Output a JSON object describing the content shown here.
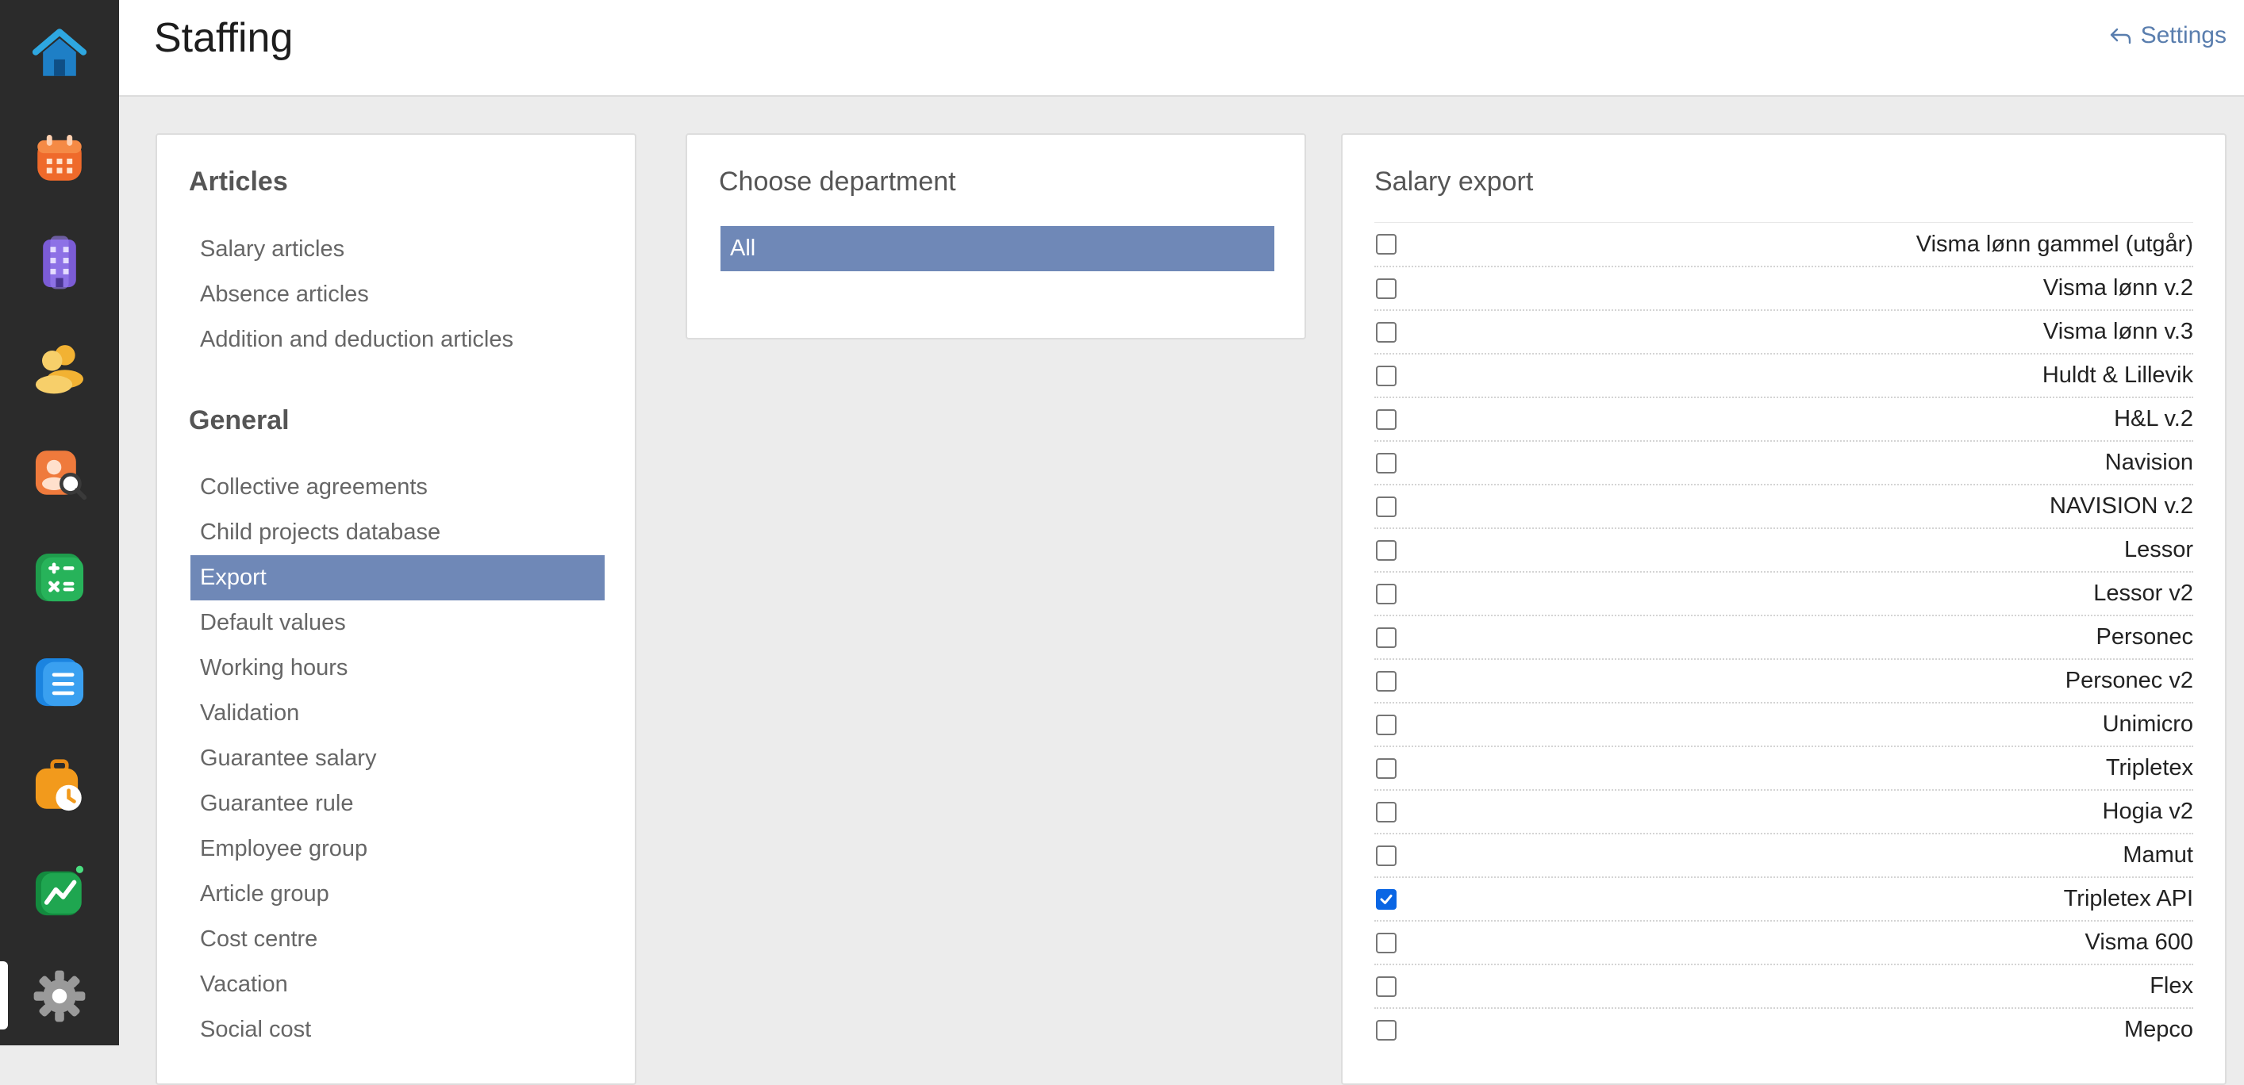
{
  "header": {
    "title": "Staffing",
    "settings_label": "Settings"
  },
  "rail": {
    "items": [
      "home-icon",
      "calendar-icon",
      "building-icon",
      "people-icon",
      "person-search-icon",
      "calculator-icon",
      "document-list-icon",
      "clock-briefcase-icon",
      "chart-icon",
      "gear-icon"
    ],
    "active": "gear-icon"
  },
  "articles": {
    "title": "Articles",
    "items": [
      "Salary articles",
      "Absence articles",
      "Addition and deduction articles"
    ]
  },
  "general": {
    "title": "General",
    "items": [
      "Collective agreements",
      "Child projects database",
      "Export",
      "Default values",
      "Working hours",
      "Validation",
      "Guarantee salary",
      "Guarantee rule",
      "Employee group",
      "Article group",
      "Cost centre",
      "Vacation",
      "Social cost"
    ],
    "active": "Export"
  },
  "department": {
    "title": "Choose department",
    "selected": "All"
  },
  "salary_export": {
    "title": "Salary export",
    "options": [
      {
        "label": "Visma lønn gammel (utgår)",
        "checked": false
      },
      {
        "label": "Visma lønn v.2",
        "checked": false
      },
      {
        "label": "Visma lønn v.3",
        "checked": false
      },
      {
        "label": "Huldt & Lillevik",
        "checked": false
      },
      {
        "label": "H&L v.2",
        "checked": false
      },
      {
        "label": "Navision",
        "checked": false
      },
      {
        "label": "NAVISION v.2",
        "checked": false
      },
      {
        "label": "Lessor",
        "checked": false
      },
      {
        "label": "Lessor v2",
        "checked": false
      },
      {
        "label": "Personec",
        "checked": false
      },
      {
        "label": "Personec v2",
        "checked": false
      },
      {
        "label": "Unimicro",
        "checked": false
      },
      {
        "label": "Tripletex",
        "checked": false
      },
      {
        "label": "Hogia v2",
        "checked": false
      },
      {
        "label": "Mamut",
        "checked": false
      },
      {
        "label": "Tripletex API",
        "checked": true
      },
      {
        "label": "Visma 600",
        "checked": false
      },
      {
        "label": "Flex",
        "checked": false
      },
      {
        "label": "Mepco",
        "checked": false
      }
    ]
  },
  "colors": {
    "rail_bg": "#2b2b2b",
    "selected_bg": "#6f88b7",
    "link": "#5a7eae",
    "checkbox_checked": "#0a66e4"
  }
}
